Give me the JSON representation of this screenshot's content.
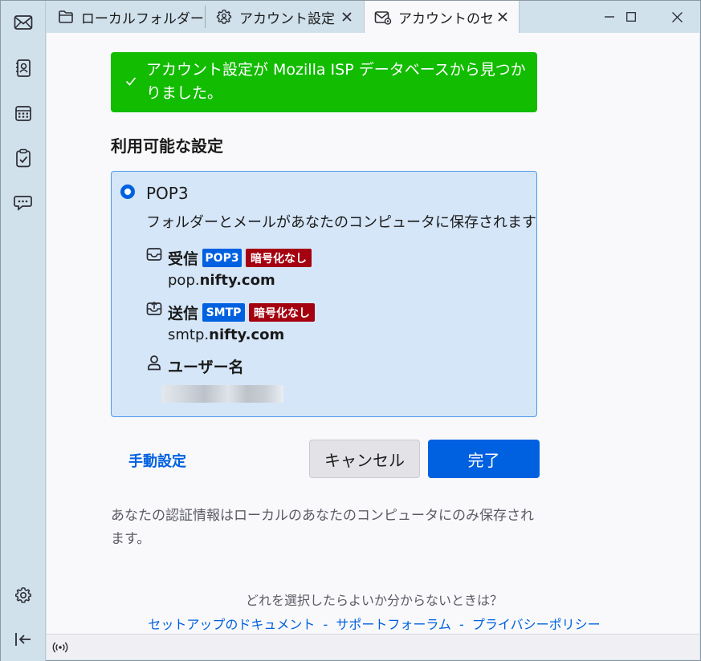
{
  "tabs": [
    {
      "label": "ローカルフォルダー",
      "icon": "folder-icon"
    },
    {
      "label": "アカウント設定",
      "icon": "account-settings-icon"
    },
    {
      "label": "アカウントのセッ",
      "icon": "mail-setup-icon"
    }
  ],
  "window_controls": {
    "minimize": "minimize-icon",
    "maximize": "maximize-icon",
    "close": "close-icon"
  },
  "spaces": [
    "mail-icon",
    "address-book-icon",
    "calendar-icon",
    "tasks-icon",
    "chat-icon",
    "settings-icon",
    "collapse-icon"
  ],
  "banner": {
    "message": "アカウント設定が Mozilla ISP データベースから見つかりました。",
    "color": "#12bc00"
  },
  "section_title": "利用可能な設定",
  "config": {
    "protocol": "POP3",
    "description": "フォルダーとメールがあなたのコンピュータに保存されます",
    "incoming": {
      "label": "受信",
      "protocol_badge": "POP3",
      "security_badge": "暗号化なし",
      "host_prefix": "pop.",
      "host_domain": "nifty.com"
    },
    "outgoing": {
      "label": "送信",
      "protocol_badge": "SMTP",
      "security_badge": "暗号化なし",
      "host_prefix": "smtp.",
      "host_domain": "nifty.com"
    },
    "username": {
      "label": "ユーザー名"
    }
  },
  "actions": {
    "manual": "手動設定",
    "cancel": "キャンセル",
    "done": "完了"
  },
  "note": "あなたの認証情報はローカルのあなたのコンピュータにのみ保存されます。",
  "help": {
    "question": "どれを選択したらよいか分からないときは？",
    "links": [
      "セットアップのドキュメント",
      "サポートフォーラム",
      "プライバシーポリシー"
    ],
    "separator": "-"
  },
  "colors": {
    "accent": "#0061e0",
    "warning": "#a4000f",
    "success": "#12bc00"
  }
}
